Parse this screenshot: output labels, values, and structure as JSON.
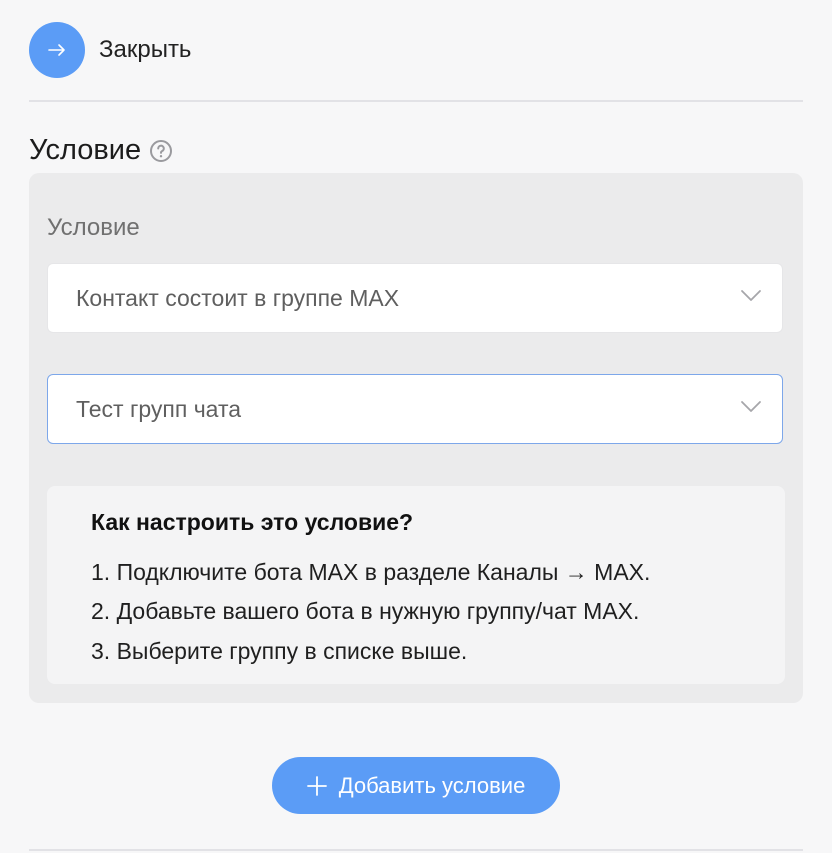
{
  "header": {
    "close_label": "Закрыть"
  },
  "section": {
    "title": "Условие",
    "field_label": "Условие",
    "condition_select": {
      "value": "Контакт состоит в группе MAX"
    },
    "group_select": {
      "value": "Тест групп чата"
    },
    "help": {
      "title": "Как настроить это условие?",
      "steps": [
        "1. Подключите бота MAX в разделе Каналы → MAX.",
        "2. Добавьте вашего бота в нужную группу/чат MAX.",
        "3. Выберите группу в списке выше."
      ]
    }
  },
  "footer": {
    "add_condition_label": "Добавить условие"
  },
  "colors": {
    "accent": "#5b9cf6",
    "panel": "#ebebec",
    "focus_border": "#7da7ea"
  },
  "icons": {
    "close": "arrow-right-icon",
    "help": "question-circle-icon",
    "dropdown": "chevron-down-icon",
    "add": "plus-icon"
  }
}
